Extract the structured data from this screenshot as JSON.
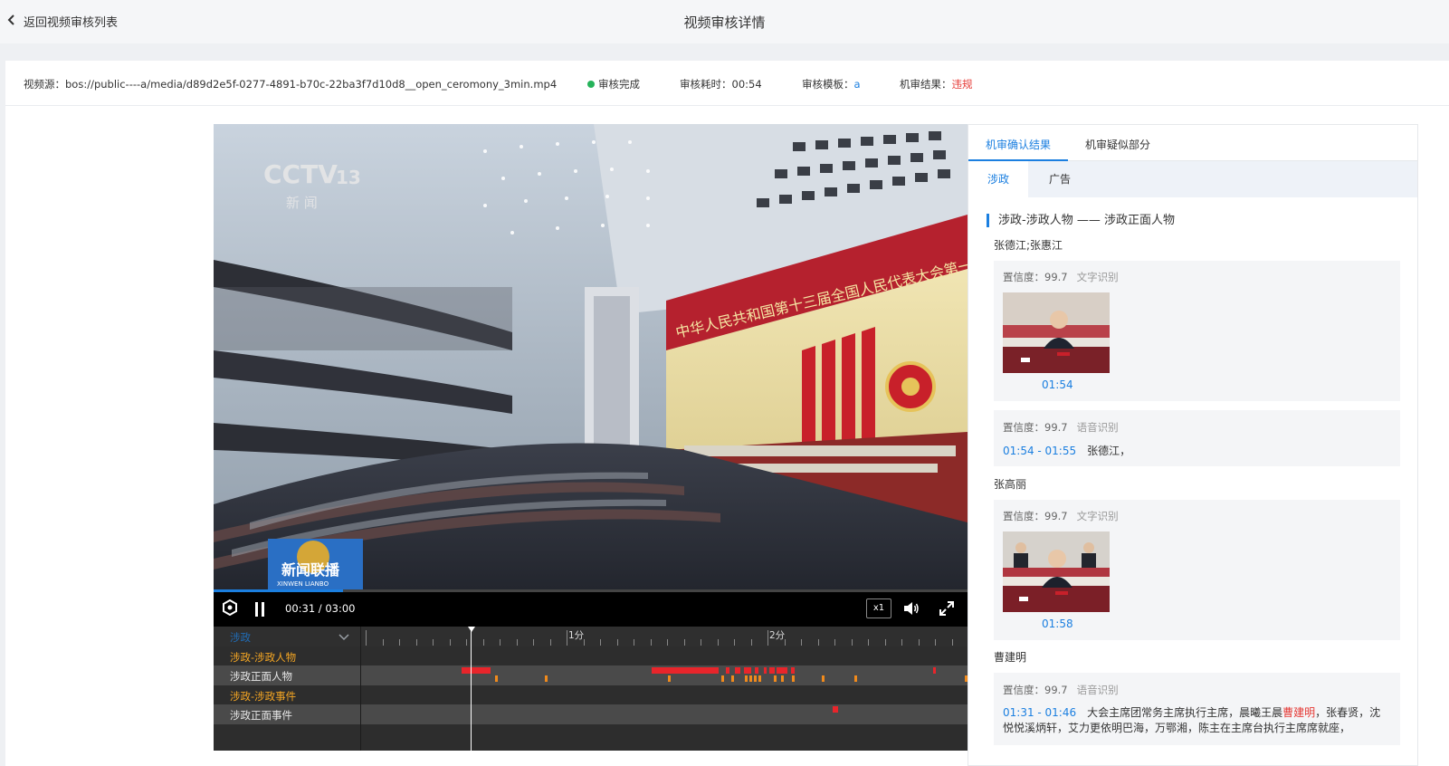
{
  "header": {
    "back_label": "返回视频审核列表",
    "title": "视频审核详情"
  },
  "info": {
    "source_label": "视频源：",
    "source_value": "bos://public----a/media/d89d2e5f-0277-4891-b70c-22ba3f7d10d8__open_ceromony_3min.mp4",
    "status": "审核完成",
    "duration_label": "审核耗时：",
    "duration_value": "00:54",
    "template_label": "审核模板：",
    "template_value": "a",
    "result_label": "机审结果：",
    "result_value": "违规"
  },
  "video": {
    "overlay_channel": "CCTV",
    "overlay_channel_num": "13",
    "overlay_sub": "新 闻",
    "banner_text": "中华人民共和国第十三届全国人民代表大会第一次会议",
    "logo_text": "新闻联播",
    "logo_sub": "XINWEN LIANBO"
  },
  "player": {
    "current_time": "00:31",
    "total_time": "03:00",
    "separator": " / ",
    "speed": "x1"
  },
  "timeline": {
    "dropdown_label": "涉政",
    "ruler_labels": [
      "1分",
      "2分"
    ],
    "rows": [
      {
        "label": "涉政-涉政人物",
        "style": "orange"
      },
      {
        "label": "涉政正面人物",
        "style": "white"
      },
      {
        "label": "涉政-涉政事件",
        "style": "orange"
      },
      {
        "label": "涉政正面事件",
        "style": "white"
      }
    ]
  },
  "right_panel": {
    "tabs": [
      "机审确认结果",
      "机审疑似部分"
    ],
    "subtabs": [
      "涉政",
      "广告"
    ],
    "section_title": "涉政-涉政人物 —— 涉政正面人物",
    "persons": [
      {
        "name": "张德江;张惠江",
        "card1": {
          "conf_label": "置信度：",
          "conf_value": "99.7",
          "type": "文字识别",
          "time": "01:54"
        },
        "card2": {
          "conf_label": "置信度：",
          "conf_value": "99.7",
          "type": "语音识别",
          "time": "01:54 - 01:55",
          "text": "张德江，"
        }
      },
      {
        "name": "张高丽",
        "card1": {
          "conf_label": "置信度：",
          "conf_value": "99.7",
          "type": "文字识别",
          "time": "01:58"
        }
      },
      {
        "name": "曹建明",
        "card1": {
          "conf_label": "置信度：",
          "conf_value": "99.7",
          "type": "语音识别",
          "time": "01:31 - 01:46",
          "text_a": "大会主席团常务主席执行主席，晨曦王晨",
          "text_hl": "曹建明",
          "text_b": "，张春贤，沈悦悦溪炳轩，艾力更依明巴海，万鄂湘，陈主在主席台执行主席席就座，"
        }
      }
    ]
  },
  "colors": {
    "accent": "#1b7fe0",
    "success": "#25b35a",
    "danger": "#e53935",
    "timeline_red": "#e8252b",
    "timeline_orange": "#f08a1c"
  }
}
